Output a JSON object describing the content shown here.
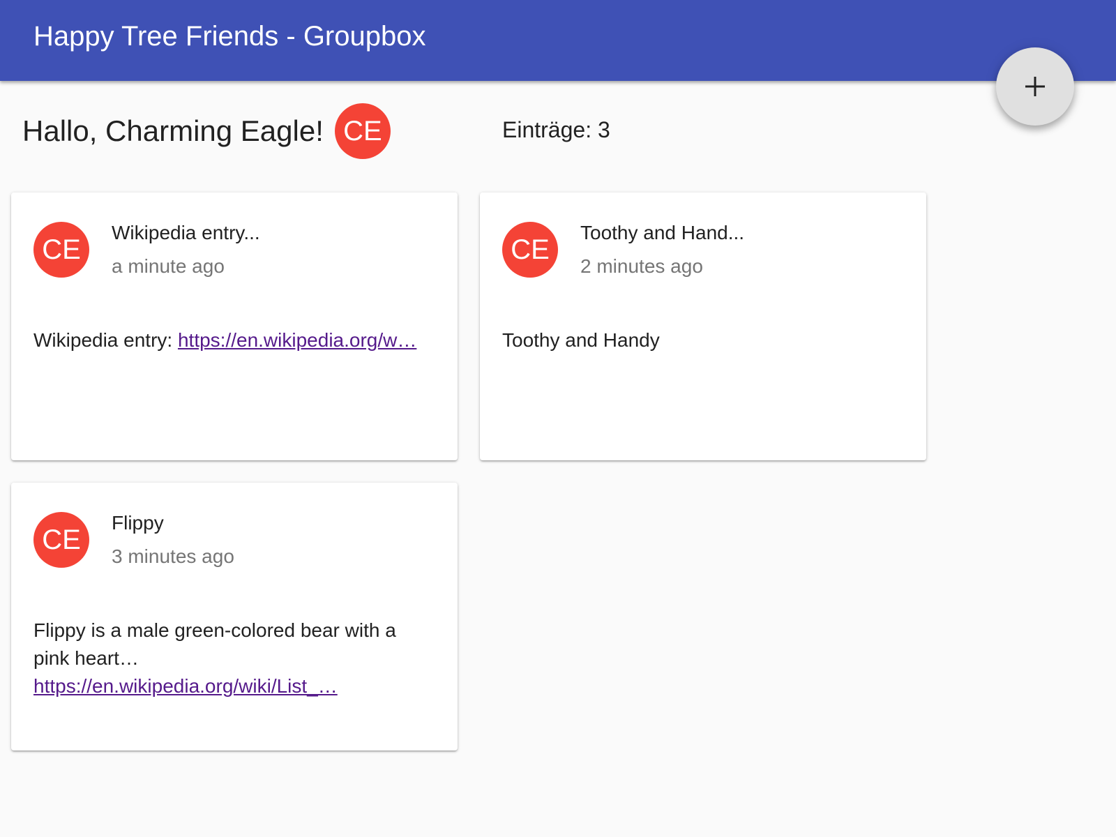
{
  "appbar": {
    "title": "Happy Tree Friends - Groupbox"
  },
  "fab": {
    "icon": "plus-icon",
    "label": "+"
  },
  "header": {
    "greeting": "Hallo, Charming Eagle!",
    "avatar_initials": "CE",
    "entry_count": "Einträge: 3"
  },
  "colors": {
    "appbar": "#3f51b5",
    "avatar": "#f44336",
    "fab": "#e0e0e0",
    "link": "#551a8b"
  },
  "cards": [
    {
      "avatar_initials": "CE",
      "title": "Wikipedia entry...",
      "subtitle": "a minute ago",
      "text": "Wikipedia entry: ",
      "link": "https://en.wikipedia.org/w…"
    },
    {
      "avatar_initials": "CE",
      "title": "Toothy and Hand...",
      "subtitle": "2 minutes ago",
      "text": "Toothy and Handy",
      "link": ""
    },
    {
      "avatar_initials": "CE",
      "title": "Flippy",
      "subtitle": "3 minutes ago",
      "text": "Flippy is a male green-colored bear with a pink heart…",
      "link": "https://en.wikipedia.org/wiki/List_…"
    }
  ]
}
